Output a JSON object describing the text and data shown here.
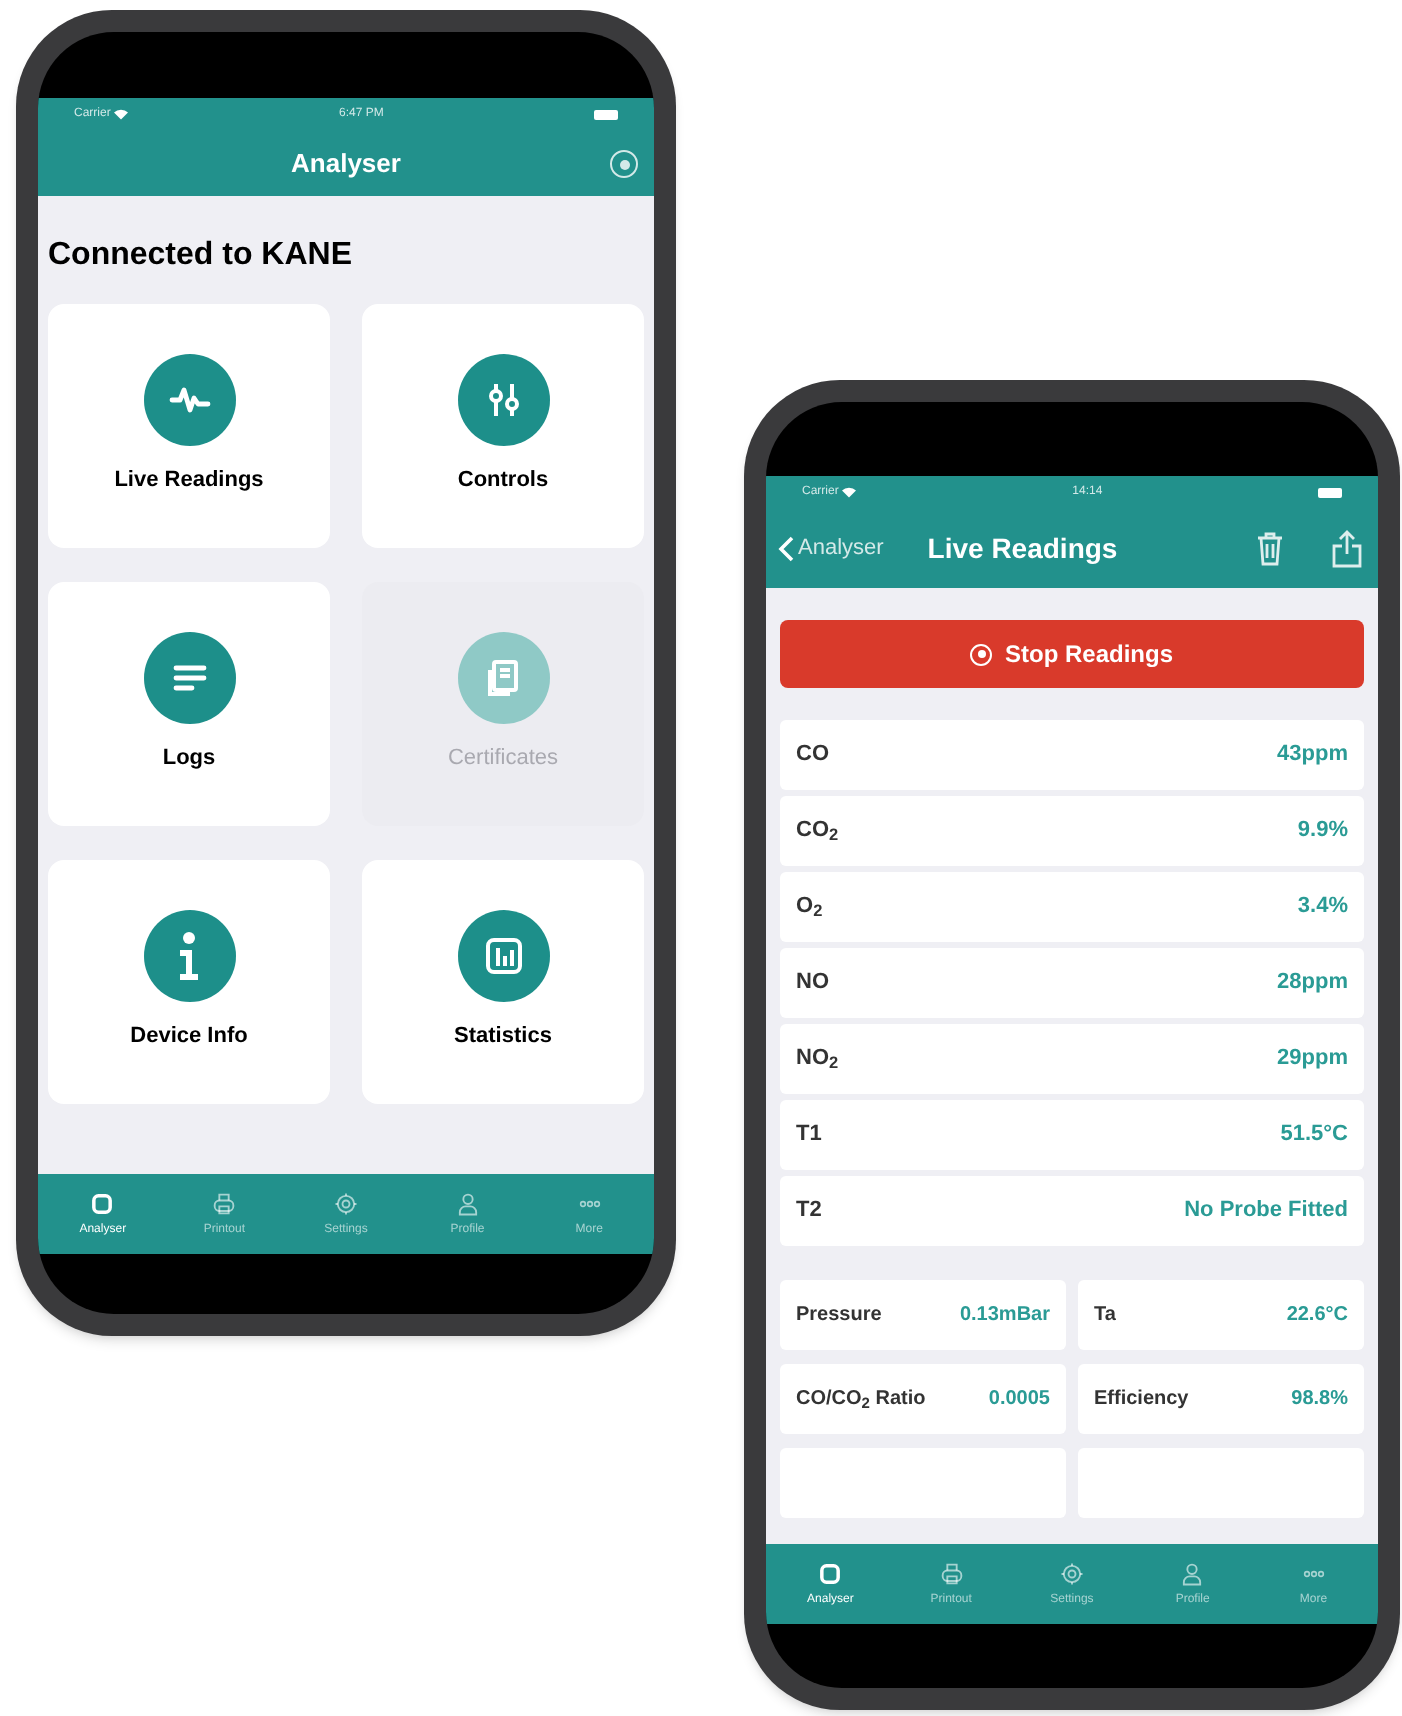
{
  "left_phone": {
    "status_bar": {
      "carrier": "Carrier",
      "time": "6:47 PM"
    },
    "nav_bar": {
      "title": "Analyser"
    },
    "heading": "Connected to KANE",
    "tiles": [
      {
        "label": "Live Readings",
        "kind": "pulse",
        "disabled": false
      },
      {
        "label": "Controls",
        "kind": "sliders",
        "disabled": false
      },
      {
        "label": "Logs",
        "kind": "lines",
        "disabled": false
      },
      {
        "label": "Certificates",
        "kind": "doc",
        "disabled": true
      },
      {
        "label": "Device Info",
        "kind": "info",
        "disabled": false
      },
      {
        "label": "Statistics",
        "kind": "bars",
        "disabled": false
      }
    ],
    "tab_bar": [
      {
        "label": "Analyser",
        "kind": "square",
        "selected": true
      },
      {
        "label": "Printout",
        "kind": "printer",
        "selected": false
      },
      {
        "label": "Settings",
        "kind": "gear",
        "selected": false
      },
      {
        "label": "Profile",
        "kind": "person",
        "selected": false
      },
      {
        "label": "More",
        "kind": "dots",
        "selected": false
      }
    ]
  },
  "right_phone": {
    "status_bar": {
      "carrier": "Carrier",
      "time": "14:14"
    },
    "nav_bar": {
      "back": "Analyser",
      "title": "Live Readings"
    },
    "stop_button": "Stop Readings",
    "readings": [
      {
        "name": "CO",
        "value": "43ppm"
      },
      {
        "name": "CO$_{2}$",
        "value": "9.9%"
      },
      {
        "name": "O$_{2}$",
        "value": "3.4%"
      },
      {
        "name": "NO",
        "value": "28ppm"
      },
      {
        "name": "NO$_{2}$",
        "value": "29ppm"
      },
      {
        "name": "T1",
        "value": "51.5°C"
      },
      {
        "name": "T2",
        "value": "No Probe Fitted"
      }
    ],
    "pairs": [
      {
        "name": "Pressure",
        "value": "0.13mBar"
      },
      {
        "name": "Ta",
        "value": "22.6°C"
      },
      {
        "name": "CO/CO$_{2}$ Ratio",
        "value": "0.0005"
      },
      {
        "name": "Efficiency",
        "value": "98.8%"
      }
    ],
    "tab_bar": [
      {
        "label": "Analyser",
        "kind": "square",
        "selected": true
      },
      {
        "label": "Printout",
        "kind": "printer",
        "selected": false
      },
      {
        "label": "Settings",
        "kind": "gear",
        "selected": false
      },
      {
        "label": "Profile",
        "kind": "person",
        "selected": false
      },
      {
        "label": "More",
        "kind": "dots",
        "selected": false
      }
    ]
  }
}
